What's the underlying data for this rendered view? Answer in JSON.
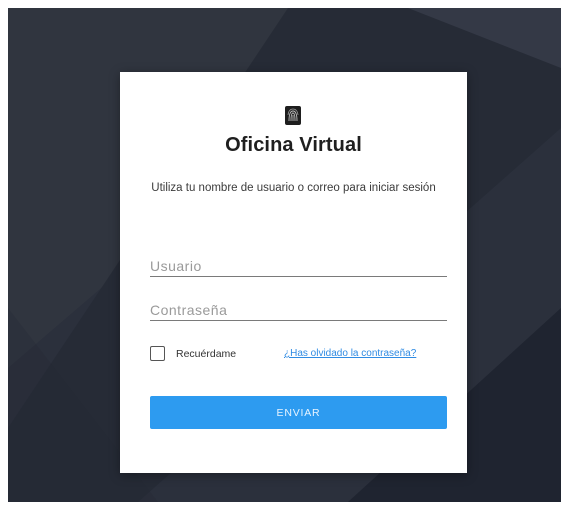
{
  "login": {
    "title": "Oficina Virtual",
    "subtitle": "Utiliza tu nombre de usuario o correo para iniciar sesión",
    "username_placeholder": "Usuario",
    "password_placeholder": "Contraseña",
    "remember_label": "Recuérdame",
    "remember_checked": false,
    "forgot_link": "¿Has olvidado la contraseña?",
    "submit_label": "ENVIAR"
  },
  "colors": {
    "background": "#2a2f3b",
    "card": "#ffffff",
    "accent": "#2d9bf0",
    "link": "#2f8be3"
  },
  "icons": {
    "logo": "fingerprint-icon",
    "checkbox": "checkbox-icon"
  }
}
